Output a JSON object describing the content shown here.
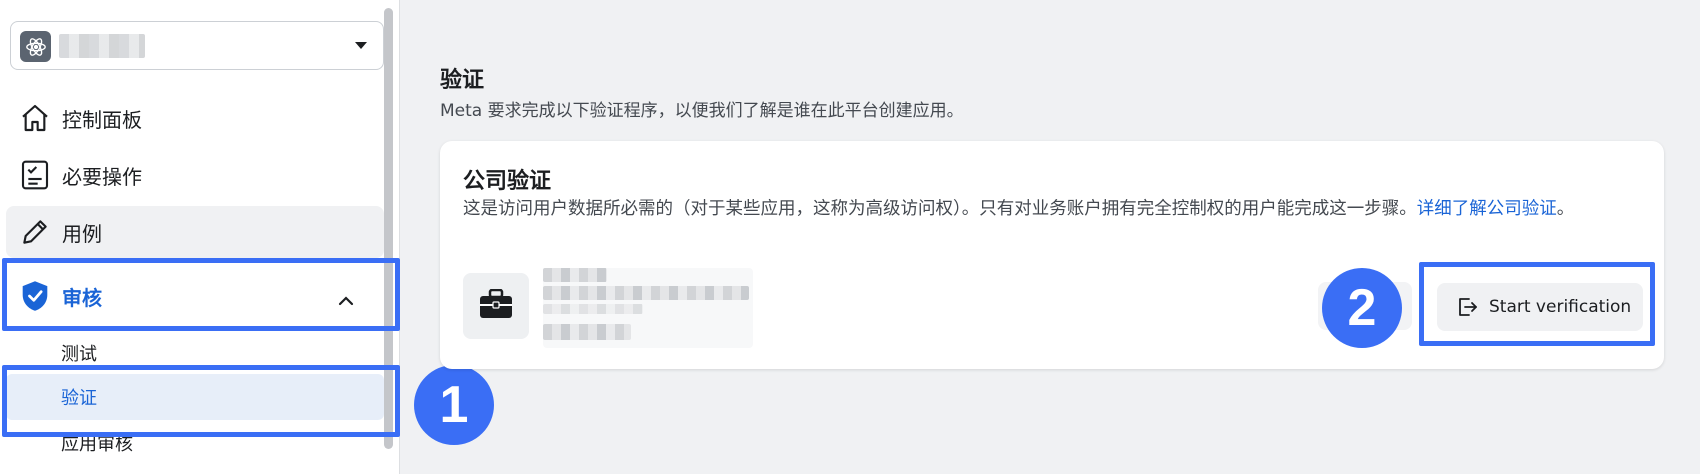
{
  "sidebar": {
    "app_selector": {
      "icon": "atom-icon",
      "name_blurred": true
    },
    "nav": [
      {
        "label": "控制面板",
        "icon": "home-icon"
      },
      {
        "label": "必要操作",
        "icon": "checklist-icon"
      },
      {
        "label": "用例",
        "icon": "pencil-icon"
      },
      {
        "label": "审核",
        "icon": "shield-check-icon",
        "active": true,
        "expanded": true
      }
    ],
    "sub_items": [
      {
        "label": "测试"
      },
      {
        "label": "验证",
        "selected": true
      },
      {
        "label": "应用审核"
      }
    ]
  },
  "main": {
    "title": "验证",
    "subtitle": "Meta 要求完成以下验证程序，以便我们了解是谁在此平台创建应用。",
    "card": {
      "title": "公司验证",
      "description": "这是访问用户数据所必需的（对于某些应用，这称为高级访问权）。只有对业务账户拥有完全控制权的用户能完成这一步骤。",
      "link": "详细了解公司验证",
      "trailing": "。",
      "business_icon": "briefcase-icon",
      "button_label": "Start verification",
      "button_icon": "exit-door-icon"
    }
  },
  "annotations": {
    "badge_1": "1",
    "badge_2": "2",
    "highlight_color": "#3a6ef5"
  },
  "colors": {
    "accent": "#1a64d6",
    "selected_bg": "#e7eef9"
  }
}
